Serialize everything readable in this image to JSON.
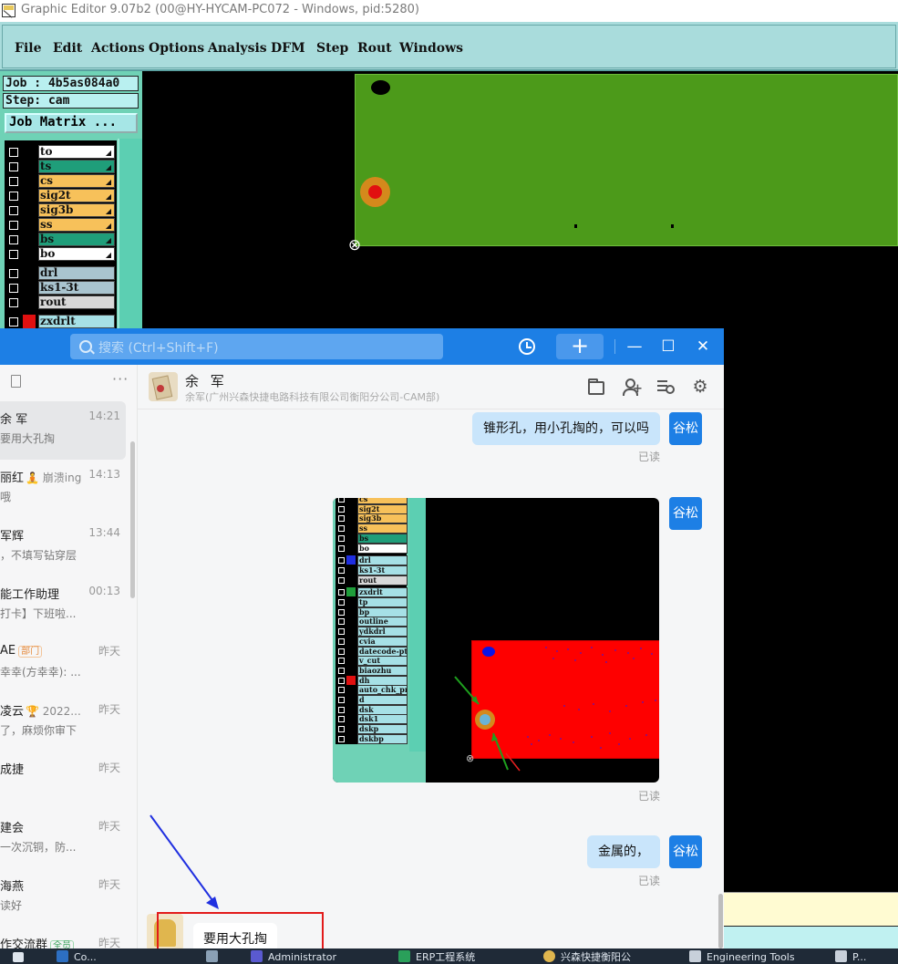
{
  "cam": {
    "title": "Graphic Editor 9.07b2 (00@HY-HYCAM-PC072 - Windows, pid:5280)",
    "menu": [
      "File",
      "Edit",
      "Actions",
      "Options",
      "Analysis",
      "DFM",
      "Step",
      "Rout",
      "Windows"
    ],
    "job": "Job : 4b5as084a0",
    "step": "Step: cam",
    "job_matrix_button": "Job Matrix ...",
    "layers": [
      {
        "name": "to",
        "bg": "#ffffff",
        "arrow": true
      },
      {
        "name": "ts",
        "bg": "#1f9e7a",
        "arrow": true
      },
      {
        "name": "cs",
        "bg": "#f7c15a",
        "arrow": true
      },
      {
        "name": "sig2t",
        "bg": "#f7c15a",
        "arrow": true
      },
      {
        "name": "sig3b",
        "bg": "#f7c15a",
        "arrow": true
      },
      {
        "name": "ss",
        "bg": "#f7c15a",
        "arrow": true
      },
      {
        "name": "bs",
        "bg": "#1f9e7a",
        "arrow": true
      },
      {
        "name": "bo",
        "bg": "#ffffff",
        "arrow": true
      },
      {
        "name": "drl",
        "bg": "#a9c4cf",
        "arrow": false
      },
      {
        "name": "ks1-3t",
        "bg": "#a9c4cf",
        "arrow": false
      },
      {
        "name": "rout",
        "bg": "#d8d8d8",
        "arrow": false
      },
      {
        "name": "zxdrlt",
        "bg": "#a6e0e6",
        "arrow": false
      }
    ]
  },
  "chat": {
    "search_placeholder": "搜索 (Ctrl+Shift+F)",
    "add_button": "+",
    "conversations": [
      {
        "name": "余 军",
        "time": "14:21",
        "preview": "要用大孔掏",
        "active": true
      },
      {
        "name": "丽红",
        "status": "🧘 崩溃ing",
        "time": "14:13",
        "preview": "哦"
      },
      {
        "name": "军辉",
        "time": "13:44",
        "preview": "，不填写钻穿层"
      },
      {
        "name": "能工作助理",
        "time": "00:13",
        "preview": "打卡】下班啦..."
      },
      {
        "name": "AE",
        "tag": "部门",
        "time": "昨天",
        "preview": "幸幸(方幸幸): ..."
      },
      {
        "name": "凌云",
        "status": "🏆 2022...",
        "time": "昨天",
        "preview": "了，麻烦你审下"
      },
      {
        "name": "成捷",
        "time": "昨天",
        "preview": ""
      },
      {
        "name": "建会",
        "time": "昨天",
        "preview": "一次沉铜，防..."
      },
      {
        "name": "海燕",
        "time": "昨天",
        "preview": "读好"
      },
      {
        "name": "作交流群",
        "tag": "全员",
        "time": "昨天",
        "preview": ""
      }
    ],
    "header": {
      "name": "余 军",
      "subtitle": "余军(广州兴森快捷电路科技有限公司衡阳分公司-CAM部)"
    },
    "messages": [
      {
        "text": "锥形孔，用小孔掏的，可以吗",
        "sender": "谷松",
        "status": "已读"
      },
      {
        "type": "image",
        "sender": "谷松",
        "status": "已读"
      },
      {
        "text": "金属的，",
        "sender": "谷松",
        "status": "已读"
      },
      {
        "text": "要用大孔掏",
        "sender": "余军"
      }
    ],
    "image_layers": [
      "cs",
      "sig2t",
      "sig3b",
      "ss",
      "bs",
      "bo",
      "drl",
      "ks1-3t",
      "rout",
      "zxdrlt",
      "tp",
      "bp",
      "outline",
      "ydkdrl",
      "cvia",
      "datecode-pte",
      "v_cut",
      "biaozhu",
      "dh",
      "auto_chk_pn",
      "d",
      "dsk",
      "dsk1",
      "dskp",
      "dskbp"
    ]
  },
  "taskbar": {
    "items": [
      "Co...",
      "",
      "Administrator",
      "ERP工程系统",
      "兴森快捷衡阳公",
      "Engineering Tools",
      "P..."
    ]
  }
}
